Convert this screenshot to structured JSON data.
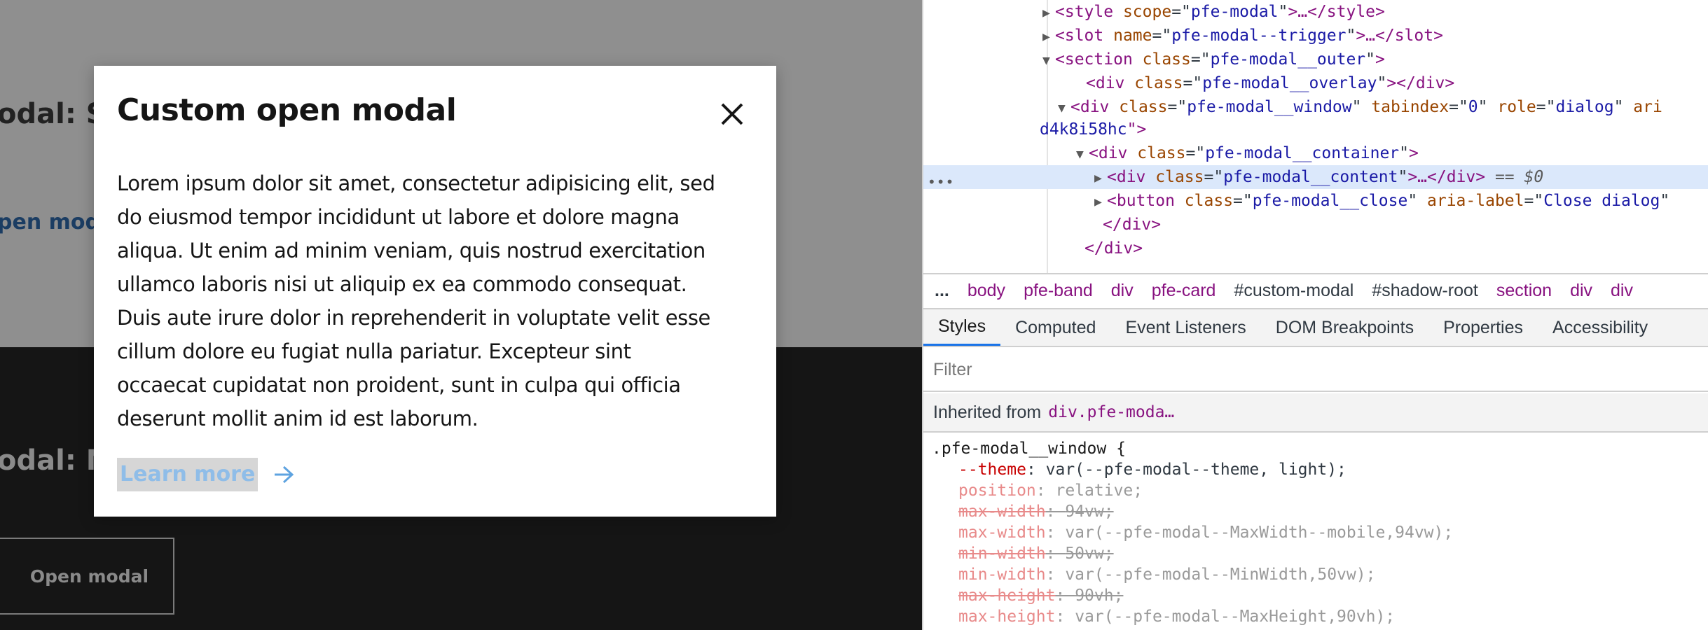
{
  "page": {
    "bg_heading_1": "odal: S",
    "bg_link": "pen modal",
    "bg_heading_2": "odal: N",
    "bg_open_button": "Open modal"
  },
  "modal": {
    "title": "Custom open modal",
    "close_icon": "close-icon",
    "body": "Lorem ipsum dolor sit amet, consectetur adipisicing elit, sed do eiusmod tempor incididunt ut labore et dolore magna aliqua. Ut enim ad minim veniam, quis nostrud exercitation ullamco laboris nisi ut aliquip ex ea commodo consequat. Duis aute irure dolor in reprehenderit in voluptate velit esse cillum dolore eu fugiat nulla pariatur. Excepteur sint occaecat cupidatat non proident, sunt in culpa qui officia deserunt mollit anim id est laborum.",
    "link_label": "Learn more",
    "link_icon": "arrow-right-icon"
  },
  "devtools": {
    "tree": [
      {
        "tri": "▶",
        "open": "<",
        "tag": "style",
        "attrs": [
          [
            "scope",
            "pfe-modal"
          ]
        ],
        "close": ">…</style>"
      },
      {
        "tri": "▶",
        "open": "<",
        "tag": "slot",
        "attrs": [
          [
            "name",
            "pfe-modal--trigger"
          ]
        ],
        "close": ">…</slot>"
      },
      {
        "tri": "▼",
        "open": "<",
        "tag": "section",
        "attrs": [
          [
            "class",
            "pfe-modal__outer"
          ]
        ],
        "close": ">"
      },
      {
        "tri": "",
        "open": "<",
        "tag": "div",
        "attrs": [
          [
            "class",
            "pfe-modal__overlay"
          ]
        ],
        "close": "></div>"
      },
      {
        "tri": "▼",
        "open": "<",
        "tag": "div",
        "attrs": [
          [
            "class",
            "pfe-modal__window"
          ],
          [
            "tabindex",
            "0"
          ],
          [
            "role",
            "dialog"
          ]
        ],
        "close": " ari"
      },
      {
        "tri": "",
        "open": "",
        "tag": "d4k8i58hc",
        "attrs": [],
        "close": "\">"
      },
      {
        "tri": "▼",
        "open": "<",
        "tag": "div",
        "attrs": [
          [
            "class",
            "pfe-modal__container"
          ]
        ],
        "close": ">"
      },
      {
        "tri": "▶",
        "open": "<",
        "tag": "div",
        "attrs": [
          [
            "class",
            "pfe-modal__content"
          ]
        ],
        "close": ">…</div>",
        "ref": " == $0",
        "selected": true
      },
      {
        "tri": "▶",
        "open": "<",
        "tag": "button",
        "attrs": [
          [
            "class",
            "pfe-modal__close"
          ],
          [
            "aria-label",
            "Close dialog"
          ]
        ],
        "close": ""
      },
      {
        "tri": "",
        "open": "",
        "tag": "</div>",
        "attrs": [],
        "close": ""
      },
      {
        "tri": "",
        "open": "",
        "tag": "</div>",
        "attrs": [],
        "close": ""
      }
    ],
    "tree_dots": "•••",
    "breadcrumbs": [
      "body",
      "pfe-band",
      "div",
      "pfe-card",
      "#custom-modal",
      "#shadow-root",
      "section",
      "div",
      "div"
    ],
    "breadcrumb_more": "...",
    "tabs": [
      "Styles",
      "Computed",
      "Event Listeners",
      "DOM Breakpoints",
      "Properties",
      "Accessibility"
    ],
    "active_tab": "Styles",
    "filter_placeholder": "Filter",
    "inherited_label": "Inherited from",
    "inherited_selector": "div.pfe-moda…",
    "rule_selector": ".pfe-modal__window {",
    "declarations": [
      {
        "name": "--theme",
        "value": "var(--pfe-modal--theme, light);",
        "dim": false,
        "struck": false
      },
      {
        "name": "position",
        "value": "relative;",
        "dim": true,
        "struck": false
      },
      {
        "name": "max-width",
        "value": "94vw;",
        "dim": true,
        "struck": true
      },
      {
        "name": "max-width",
        "value": "var(--pfe-modal--MaxWidth--mobile,94vw);",
        "dim": true,
        "struck": false
      },
      {
        "name": "min-width",
        "value": "50vw;",
        "dim": true,
        "struck": true
      },
      {
        "name": "min-width",
        "value": "var(--pfe-modal--MinWidth,50vw);",
        "dim": true,
        "struck": false
      },
      {
        "name": "max-height",
        "value": "90vh;",
        "dim": true,
        "struck": true
      },
      {
        "name": "max-height",
        "value": "var(--pfe-modal--MaxHeight,90vh);",
        "dim": true,
        "struck": false
      }
    ]
  }
}
